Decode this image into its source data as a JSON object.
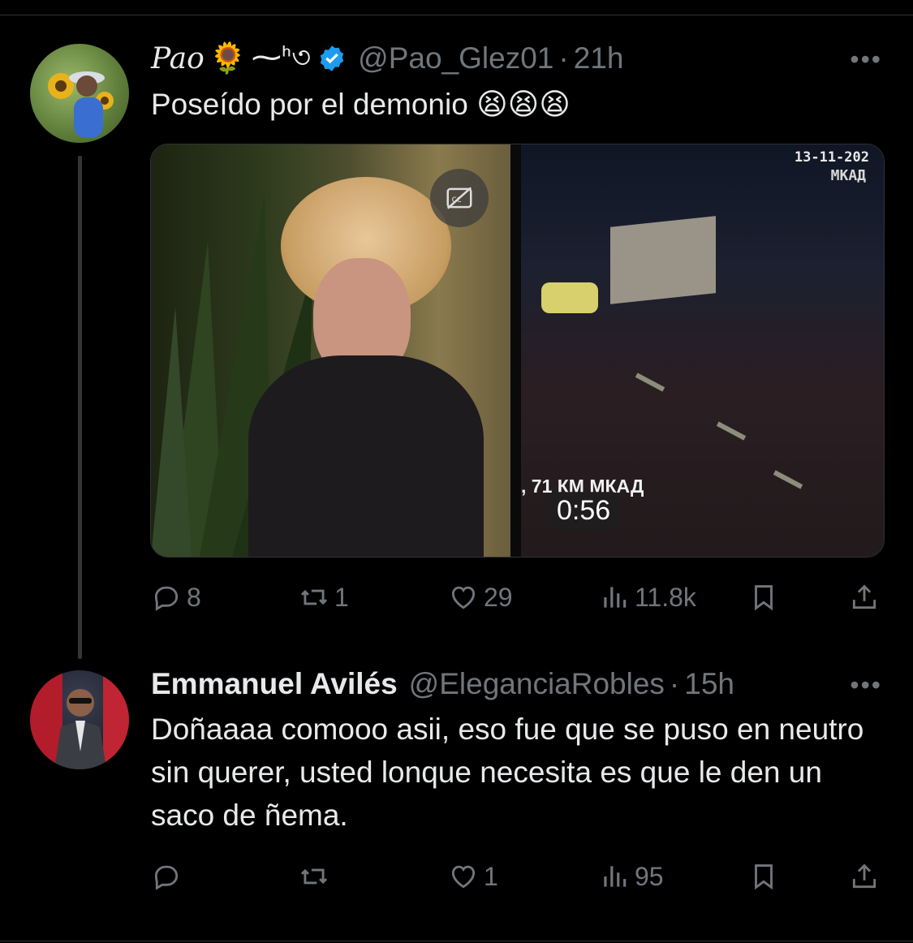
{
  "tweet1": {
    "display_name": "Pao",
    "name_emoji": "🌻",
    "name_decoration": "⁓ᑋ৩",
    "handle": "@Pao_Glez01",
    "separator": "·",
    "time": "21h",
    "text": "Poseído por el demonio 😫😫😫",
    "media": {
      "cctv_date": "13-11-202",
      "cctv_location": "МКАД",
      "cctv_km_label": ", 71 КМ МКАД",
      "duration": "0:56"
    },
    "actions": {
      "replies": "8",
      "retweets": "1",
      "likes": "29",
      "views": "11.8k"
    }
  },
  "tweet2": {
    "display_name": "Emmanuel Avilés",
    "handle": "@EleganciaRobles",
    "separator": "·",
    "time": "15h",
    "text": "Doñaaaa comooo asii, eso fue que se puso en neutro sin querer, usted lonque necesita es que le den un saco de ñema.",
    "actions": {
      "replies": "",
      "retweets": "",
      "likes": "1",
      "views": "95"
    }
  },
  "more_glyph": "•••",
  "colors": {
    "background": "#000000",
    "text": "#e7e9ea",
    "secondary": "#71767b",
    "verified": "#1d9bf0"
  }
}
